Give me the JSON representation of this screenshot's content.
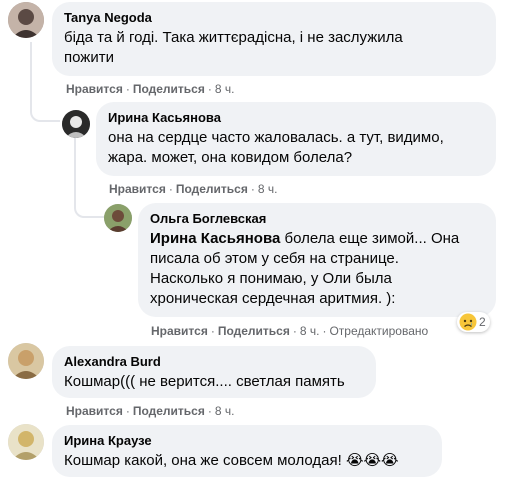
{
  "actions": {
    "like": "Нравится",
    "share": "Поделиться",
    "sep": "·"
  },
  "comments": [
    {
      "author": "Tanya Negoda",
      "text_line1": "біда та й годі. Така життєрадісна, і не заслужила",
      "text_line2": "пожити",
      "time": "8 ч."
    },
    {
      "author": "Ирина Касьянова",
      "text_line1": "она на сердце часто жаловалась. а тут, видимо,",
      "text_line2": "жара. может, она ковидом болела?",
      "time": "8 ч."
    },
    {
      "author": "Ольга Боглевская",
      "mention": "Ирина Касьянова",
      "text_line1": " болела еще зимой... Она",
      "text_line2": "писала об этом у себя на странице.",
      "text_line3": "Насколько я понимаю, у Оли была",
      "text_line4": "хроническая сердечная аритмия. ):",
      "time": "8 ч.",
      "edited": "Отредактировано",
      "reaction_count": "2",
      "reaction_icon": "sad-face-icon"
    },
    {
      "author": "Alexandra Burd",
      "text_line1": "Кошмар((( не верится.... светлая память",
      "time": "8 ч."
    },
    {
      "author": "Ирина Краузе",
      "text_line1": "Кошмар какой, она же совсем молодая!",
      "emoji": "😭😭😭"
    }
  ]
}
